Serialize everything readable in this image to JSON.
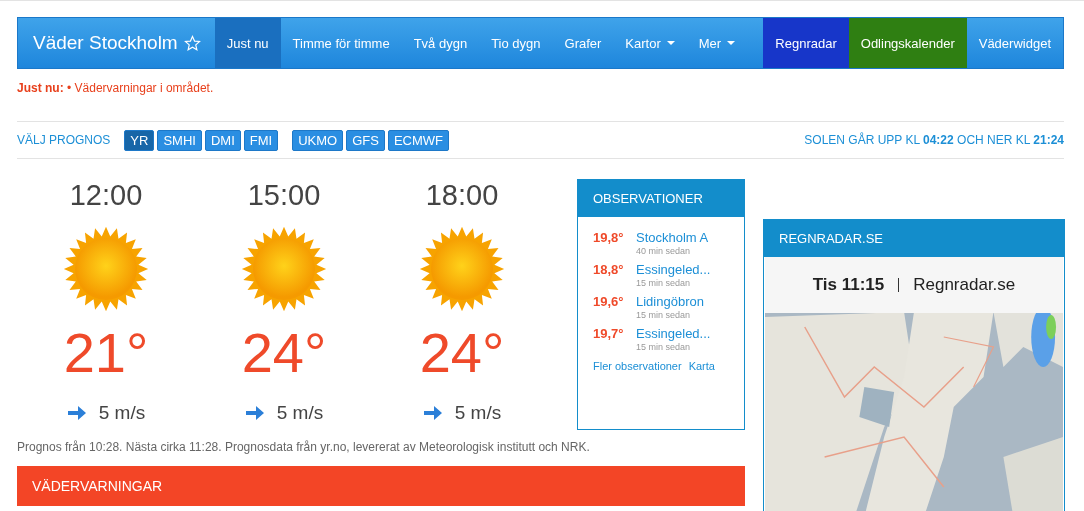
{
  "nav": {
    "brand": "Väder Stockholm",
    "items": [
      {
        "label": "Just nu",
        "selected": true,
        "dropdown": false
      },
      {
        "label": "Timme för timme",
        "selected": false,
        "dropdown": false
      },
      {
        "label": "Två dygn",
        "selected": false,
        "dropdown": false
      },
      {
        "label": "Tio dygn",
        "selected": false,
        "dropdown": false
      },
      {
        "label": "Grafer",
        "selected": false,
        "dropdown": false
      },
      {
        "label": "Kartor",
        "selected": false,
        "dropdown": true
      },
      {
        "label": "Mer",
        "selected": false,
        "dropdown": true
      },
      {
        "label": "Regnradar",
        "selected": false,
        "dropdown": false,
        "color": "#1736c9"
      },
      {
        "label": "Odlingskalender",
        "selected": false,
        "dropdown": false,
        "color": "#2f7f12"
      },
      {
        "label": "Väderwidget",
        "selected": false,
        "dropdown": false
      }
    ]
  },
  "alert": {
    "label": "Just nu:",
    "text": "• Vädervarningar i området."
  },
  "forecast_source": {
    "label": "VÄLJ PROGNOS",
    "groups": [
      [
        {
          "label": "YR",
          "selected": true
        },
        {
          "label": "SMHI",
          "selected": false
        },
        {
          "label": "DMI",
          "selected": false
        },
        {
          "label": "FMI",
          "selected": false
        }
      ],
      [
        {
          "label": "UKMO",
          "selected": false
        },
        {
          "label": "GFS",
          "selected": false
        },
        {
          "label": "ECMWF",
          "selected": false
        }
      ]
    ]
  },
  "sun": "SOLEN GÅR UPP KL **04:22** OCH NER KL **21:24**",
  "forecast": [
    {
      "time": "12:00",
      "temp": "21°",
      "wind": "5 m/s"
    },
    {
      "time": "15:00",
      "temp": "24°",
      "wind": "5 m/s"
    },
    {
      "time": "18:00",
      "temp": "24°",
      "wind": "5 m/s"
    }
  ],
  "forecast_note": "Prognos från 10:28. Nästa cirka 11:28. Prognosdata från yr.no, levererat av Meteorologisk institutt och NRK.",
  "observations": {
    "title": "OBSERVATIONER",
    "items": [
      {
        "temp": "19,8°",
        "station": "Stockholm A",
        "age": "40 min sedan"
      },
      {
        "temp": "18,8°",
        "station": "Essingeled...",
        "age": "15 min sedan"
      },
      {
        "temp": "19,6°",
        "station": "Lidingöbron",
        "age": "15 min sedan"
      },
      {
        "temp": "19,7°",
        "station": "Essingeled...",
        "age": "15 min sedan"
      }
    ],
    "links": [
      "Fler observationer",
      "Karta"
    ]
  },
  "radar": {
    "title": "REGNRADAR.SE",
    "caption_time": "Tis 11:15",
    "caption_site": "Regnradar.se"
  },
  "warnings": {
    "title": "VÄDERVARNINGAR"
  }
}
